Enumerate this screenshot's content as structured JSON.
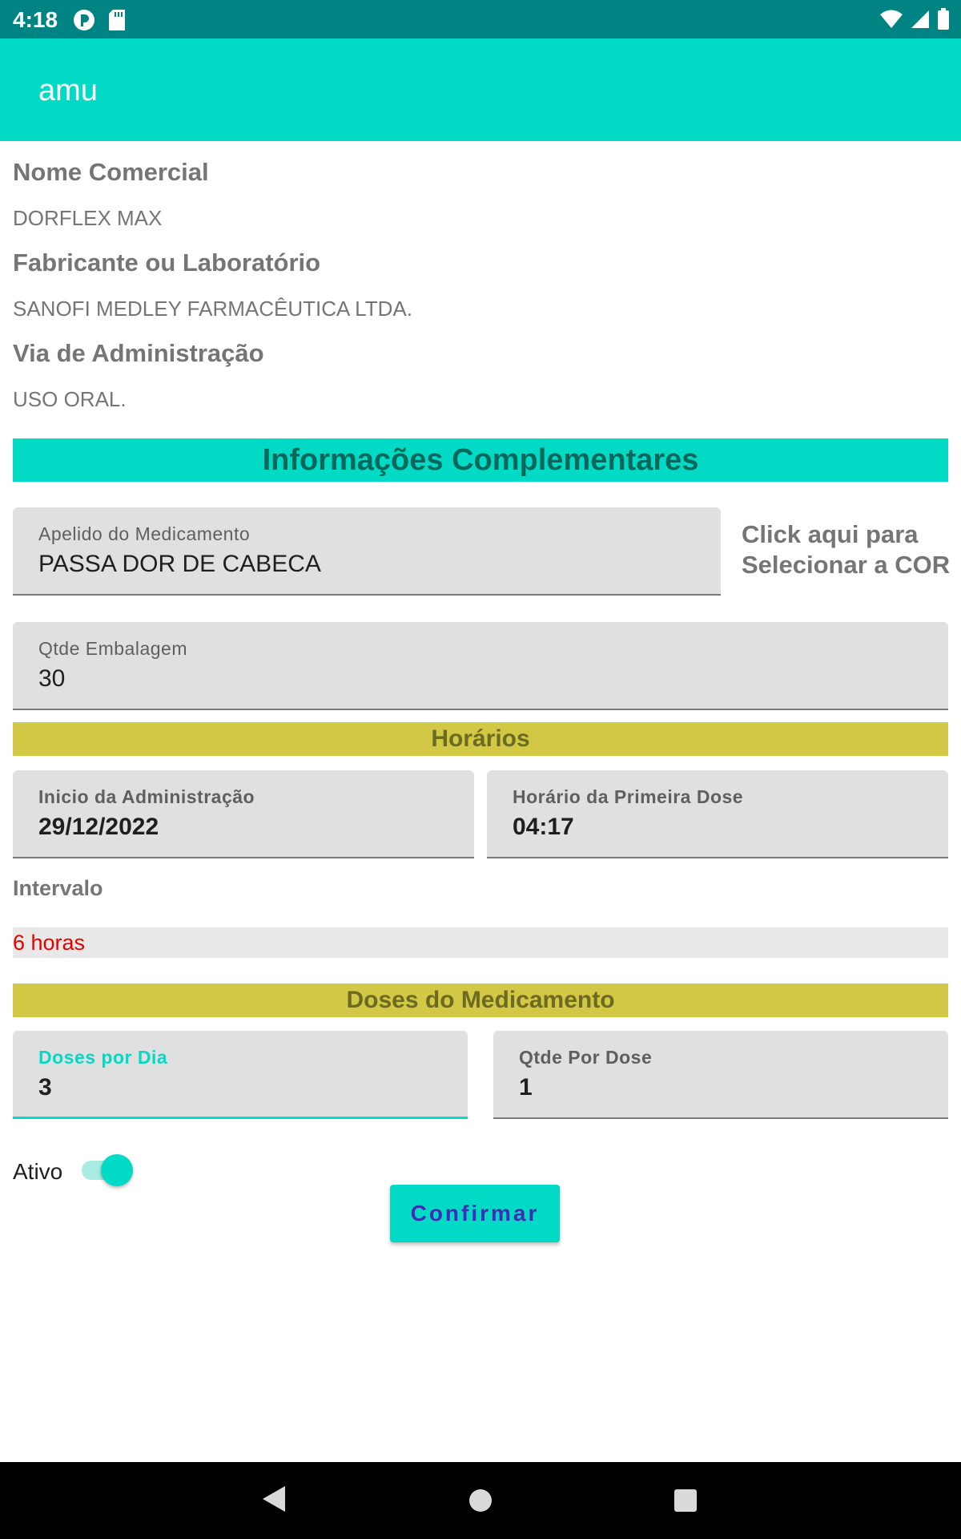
{
  "status_bar": {
    "time": "4:18",
    "left_icons": [
      "notification-icon",
      "sd-card-icon"
    ],
    "right_icons": [
      "wifi-icon",
      "cell-signal-icon",
      "battery-icon"
    ]
  },
  "app_bar": {
    "title": "amu"
  },
  "details": {
    "trade_name_label": "Nome Comercial",
    "trade_name_value": "DORFLEX MAX",
    "manufacturer_label": "Fabricante ou Laboratório",
    "manufacturer_value": "SANOFI MEDLEY FARMACÊUTICA LTDA.",
    "route_label": "Via de Administração",
    "route_value": "USO ORAL."
  },
  "complementary": {
    "section_title": "Informações Complementares",
    "nickname_label": "Apelido do Medicamento",
    "nickname_value": "PASSA DOR DE CABECA",
    "color_picker_text_line1": "Click aqui para",
    "color_picker_text_line2": "Selecionar a COR",
    "package_qty_label": "Qtde Embalagem",
    "package_qty_value": "30"
  },
  "schedule": {
    "section_title": "Horários",
    "start_label": "Inicio da Administração",
    "start_value": "29/12/2022",
    "first_dose_label": "Horário da Primeira Dose",
    "first_dose_value": "04:17",
    "interval_label": "Intervalo",
    "interval_value": "6 horas"
  },
  "doses": {
    "section_title": "Doses do Medicamento",
    "per_day_label": "Doses por Dia",
    "per_day_value": "3",
    "per_dose_label": "Qtde Por Dose",
    "per_dose_value": "1"
  },
  "active": {
    "label": "Ativo",
    "checked": true
  },
  "confirm_button": {
    "label": "Confirmar"
  },
  "colors": {
    "accent": "#03dac5",
    "status_bar": "#008383",
    "section_olive": "#d2c845",
    "interval_text": "#e60000",
    "button_text": "#3f2eb5"
  }
}
